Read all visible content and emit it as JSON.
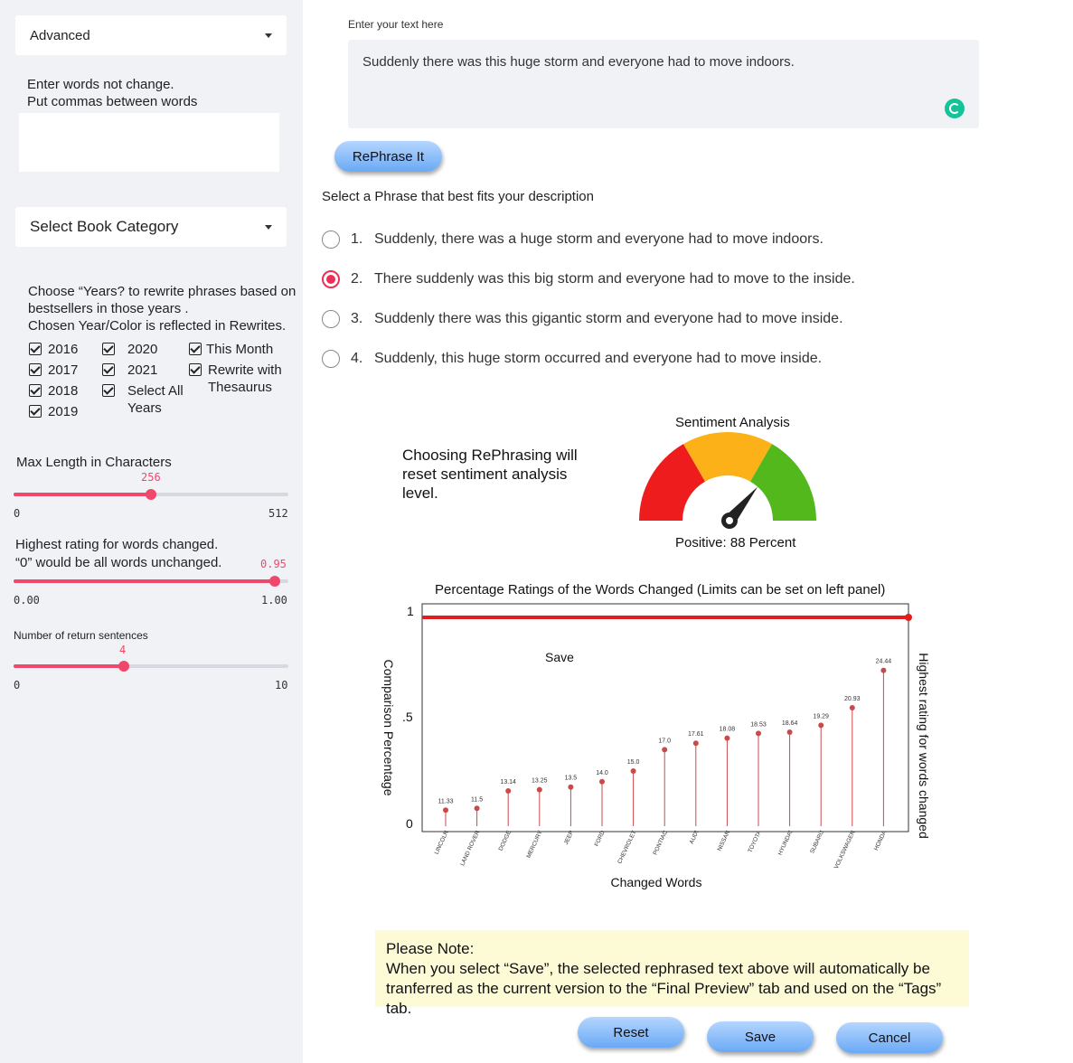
{
  "sidebar": {
    "advanced_select": "Advanced",
    "words_not_change_line1": "Enter words not change.",
    "words_not_change_line2": "Put commas between words",
    "words_not_change_value": "",
    "book_category_select": "Select Book Category",
    "years_desc_line1": "Choose “Years? to rewrite phrases based on",
    "years_desc_line2": "bestsellers in those years .",
    "years_desc_line3": "Chosen Year/Color is reflected in Rewrites.",
    "checkboxes": {
      "y2016": "2016",
      "y2017": "2017",
      "y2018": "2018",
      "y2019": "2019",
      "y2020": "2020",
      "y2021": "2021",
      "select_all_1": "Select All",
      "select_all_2": "Years",
      "this_month": "This Month",
      "thesaurus_1": "Rewrite with",
      "thesaurus_2": "Thesaurus"
    },
    "max_length": {
      "label": "Max Length in Characters",
      "value": "256",
      "min": "0",
      "max": "512",
      "fraction": 0.5
    },
    "highest_rating": {
      "label_line1": "Highest rating for words changed.",
      "label_line2": "“0” would be all words unchanged.",
      "value": "0.95",
      "min": "0.00",
      "max": "1.00",
      "fraction": 0.95
    },
    "return_sentences": {
      "label": "Number of return sentences",
      "value": "4",
      "min": "0",
      "max": "10",
      "fraction": 0.4
    }
  },
  "main": {
    "input_label": "Enter your text here",
    "input_text": "Suddenly there was this huge storm and everyone had to move indoors.",
    "rephrase_button": "RePhrase It",
    "select_label": "Select a Phrase that best fits your description",
    "options": [
      {
        "num": "1.",
        "text": "Suddenly, there was a huge storm and everyone had to move indoors.",
        "selected": false
      },
      {
        "num": "2.",
        "text": "There suddenly was this big storm and everyone had to move to the inside.",
        "selected": true
      },
      {
        "num": "3.",
        "text": "Suddenly there was this gigantic storm and everyone had to move inside.",
        "selected": false
      },
      {
        "num": "4.",
        "text": "Suddenly, this huge storm occurred and everyone had to move inside.",
        "selected": false
      }
    ],
    "choosing_note": "Choosing RePhrasing will reset sentiment analysis level.",
    "sentiment": {
      "title": "Sentiment Analysis",
      "result": "Positive: 88 Percent",
      "value": 88,
      "colors": [
        "#ee1c1c",
        "#fbb117",
        "#52b81c"
      ]
    },
    "note": {
      "heading": "Please Note:",
      "line1": "When you select “Save”, the selected rephrased text above will automatically be",
      "line2": "tranferred as the current version to the “Final Preview” tab and used on the “Tags” tab."
    },
    "buttons": {
      "reset": "Reset",
      "save": "Save",
      "cancel": "Cancel"
    }
  },
  "chart_data": {
    "type": "scatter",
    "title": "Percentage Ratings of the Words Changed (Limits can be set on left panel)",
    "xlabel": "Changed Words",
    "ylabel": "Comparison Percentage",
    "right_label": "Highest rating for words changed",
    "inner_label": "Save",
    "y_tick_labels": [
      "0",
      ".5",
      "1"
    ],
    "threshold": 1,
    "threshold_color": "#e11d1d",
    "stem_color": "#c94a4a",
    "categories": [
      "LINCOLN",
      "LAND ROVER",
      "DODGE",
      "MERCURY",
      "JEEP",
      "FORD",
      "CHEVROLET",
      "PONTIAC",
      "AUDI",
      "NISSAN",
      "TOYOTA",
      "HYUNDAI",
      "SUBARU",
      "VOLKSWAGEN",
      "HONDA"
    ],
    "values": [
      11.33,
      11.5,
      13.14,
      13.25,
      13.5,
      14.0,
      15.0,
      17.0,
      17.61,
      18.08,
      18.53,
      18.64,
      19.29,
      20.93,
      24.44
    ],
    "value_labels": [
      "11.33",
      "11.5",
      "13.14",
      "13.25",
      "13.5",
      "14.0",
      "15.0",
      "17.0",
      "17.61",
      "18.08",
      "18.53",
      "18.64",
      "19.29",
      "20.93",
      "24.44"
    ]
  }
}
